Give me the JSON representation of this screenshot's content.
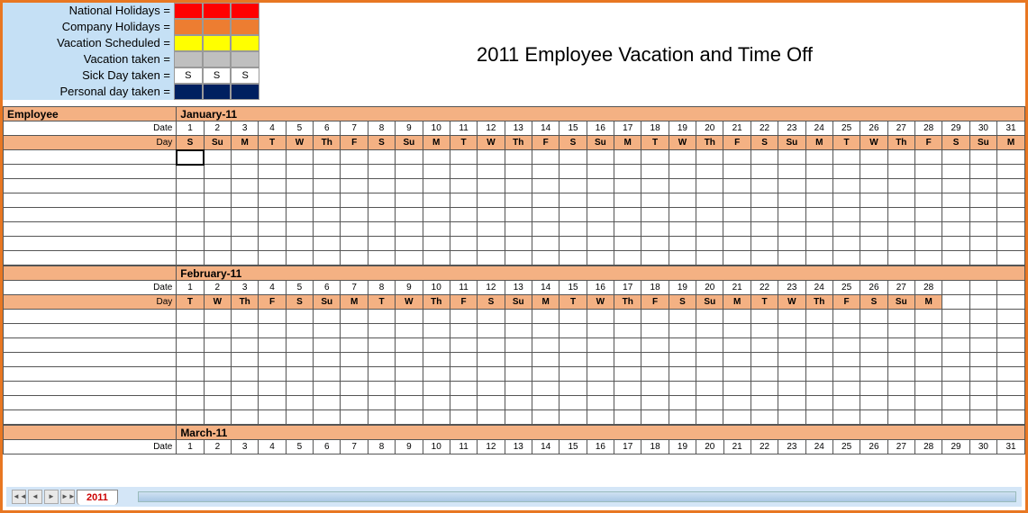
{
  "title": "2011 Employee Vacation and Time Off",
  "legend": [
    {
      "label": "National Holidays =",
      "color": "#ff0000",
      "text": ""
    },
    {
      "label": "Company Holidays =",
      "color": "#ed7d31",
      "text": ""
    },
    {
      "label": "Vacation Scheduled =",
      "color": "#ffff00",
      "text": ""
    },
    {
      "label": "Vacation taken =",
      "color": "#bfbfbf",
      "text": ""
    },
    {
      "label": "Sick Day taken =",
      "color": "#ffffff",
      "text": "S"
    },
    {
      "label": "Personal day taken =",
      "color": "#002060",
      "text": ""
    }
  ],
  "employee_header": "Employee",
  "date_label": "Date",
  "day_label": "Day",
  "months": [
    {
      "name": "January-11",
      "days": 31,
      "dates": [
        "1",
        "2",
        "3",
        "4",
        "5",
        "6",
        "7",
        "8",
        "9",
        "10",
        "11",
        "12",
        "13",
        "14",
        "15",
        "16",
        "17",
        "18",
        "19",
        "20",
        "21",
        "22",
        "23",
        "24",
        "25",
        "26",
        "27",
        "28",
        "29",
        "30",
        "31"
      ],
      "dow": [
        "S",
        "Su",
        "M",
        "T",
        "W",
        "Th",
        "F",
        "S",
        "Su",
        "M",
        "T",
        "W",
        "Th",
        "F",
        "S",
        "Su",
        "M",
        "T",
        "W",
        "Th",
        "F",
        "S",
        "Su",
        "M",
        "T",
        "W",
        "Th",
        "F",
        "S",
        "Su",
        "M"
      ],
      "rows": 8
    },
    {
      "name": "February-11",
      "days": 28,
      "dates": [
        "1",
        "2",
        "3",
        "4",
        "5",
        "6",
        "7",
        "8",
        "9",
        "10",
        "11",
        "12",
        "13",
        "14",
        "15",
        "16",
        "17",
        "18",
        "19",
        "20",
        "21",
        "22",
        "23",
        "24",
        "25",
        "26",
        "27",
        "28"
      ],
      "dow": [
        "T",
        "W",
        "Th",
        "F",
        "S",
        "Su",
        "M",
        "T",
        "W",
        "Th",
        "F",
        "S",
        "Su",
        "M",
        "T",
        "W",
        "Th",
        "F",
        "S",
        "Su",
        "M",
        "T",
        "W",
        "Th",
        "F",
        "S",
        "Su",
        "M"
      ],
      "rows": 8
    },
    {
      "name": "March-11",
      "days": 31,
      "dates": [
        "1",
        "2",
        "3",
        "4",
        "5",
        "6",
        "7",
        "8",
        "9",
        "10",
        "11",
        "12",
        "13",
        "14",
        "15",
        "16",
        "17",
        "18",
        "19",
        "20",
        "21",
        "22",
        "23",
        "24",
        "25",
        "26",
        "27",
        "28",
        "29",
        "30",
        "31"
      ],
      "dow": [],
      "rows": 0
    }
  ],
  "sheet_tab": "2011",
  "max_cols": 31
}
